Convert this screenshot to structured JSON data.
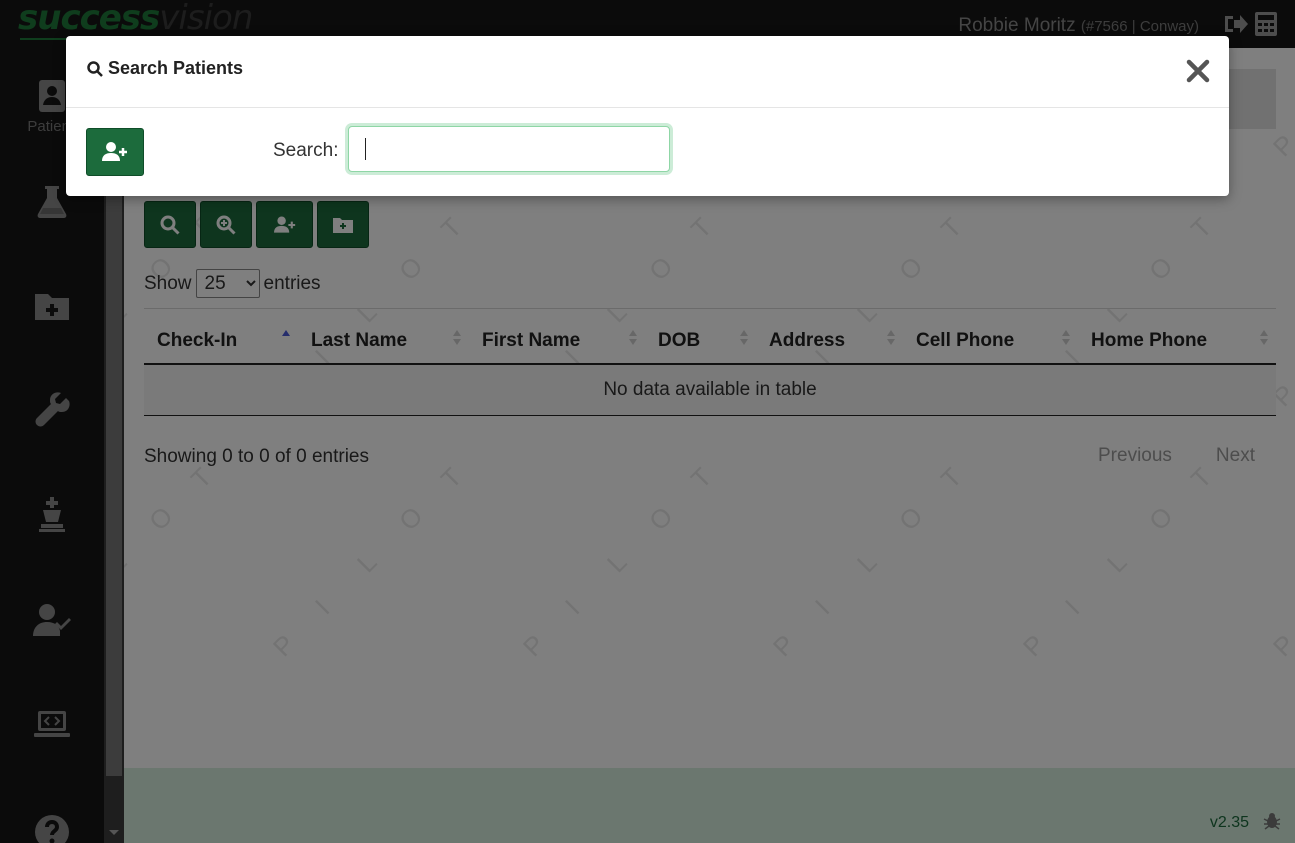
{
  "app": {
    "logo_part1": "success",
    "logo_part2": "vision"
  },
  "header": {
    "user_name": "Robbie Moritz",
    "user_meta": "(#7566 | Conway)",
    "icons": [
      "sign-out-icon",
      "calculator-icon"
    ]
  },
  "sidebar": {
    "items": [
      {
        "icon": "patient-card-icon",
        "label": "Patients"
      },
      {
        "icon": "flask-icon",
        "label": ""
      },
      {
        "icon": "folder-plus-icon",
        "label": ""
      },
      {
        "icon": "wrench-icon",
        "label": ""
      },
      {
        "icon": "chess-king-icon",
        "label": ""
      },
      {
        "icon": "user-check-icon",
        "label": ""
      },
      {
        "icon": "laptop-code-icon",
        "label": ""
      },
      {
        "icon": "question-circle-icon",
        "label": ""
      }
    ]
  },
  "main": {
    "watermark_letters": [
      "P",
      "I",
      "L",
      "O",
      "T"
    ],
    "toolbar": [
      "search-icon",
      "search-plus-icon",
      "user-plus-icon",
      "folder-plus-icon"
    ],
    "show_label": "Show",
    "entries_label": "entries",
    "page_size": "25",
    "columns": [
      "Check-In",
      "Last Name",
      "First Name",
      "DOB",
      "Address",
      "Cell Phone",
      "Home Phone"
    ],
    "sorted_column": "Check-In",
    "empty_text": "No data available in table",
    "info_text": "Showing 0 to 0 of 0 entries",
    "prev_label": "Previous",
    "next_label": "Next"
  },
  "footer": {
    "version": "v2.35"
  },
  "modal": {
    "title": "Search Patients",
    "search_label": "Search:",
    "search_value": "",
    "search_placeholder": ""
  },
  "colors": {
    "brand_green": "#1c6b3c",
    "topbar_bg": "#161616",
    "footer_bg": "#d6eedf",
    "focus_green": "#8fd6a6"
  }
}
